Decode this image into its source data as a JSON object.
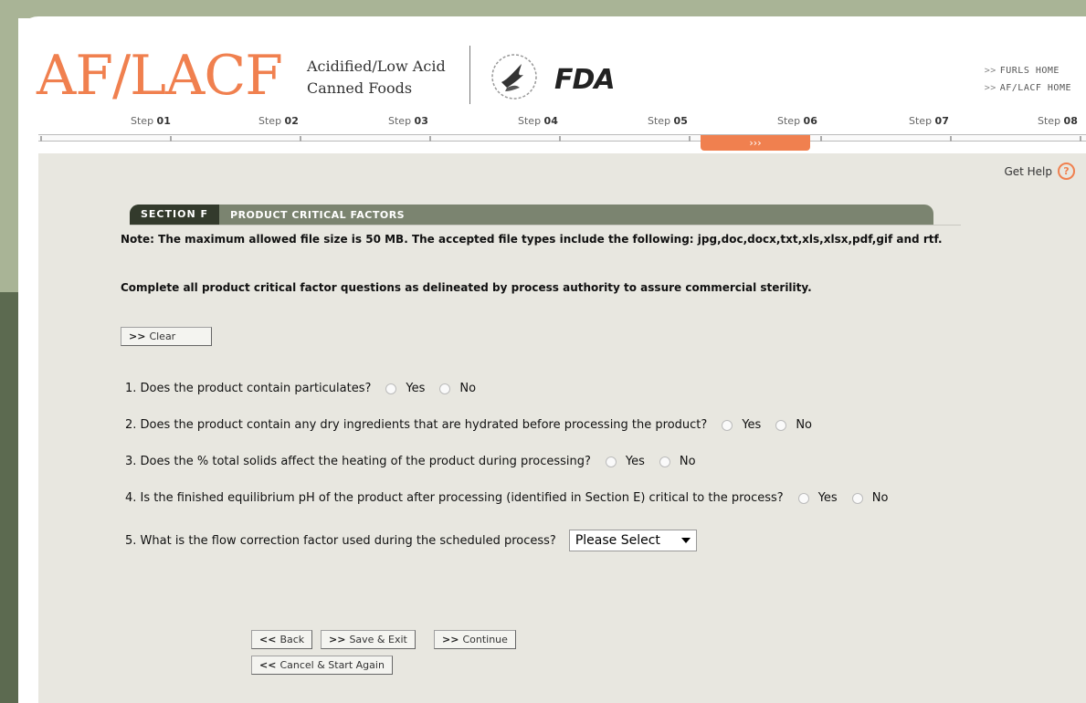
{
  "header": {
    "logo_text": "AF/LACF",
    "logo_subtitle_line1": "Acidified/Low Acid",
    "logo_subtitle_line2": "Canned Foods",
    "fda_text": "FDA",
    "links": [
      {
        "label": "FURLS HOME"
      },
      {
        "label": "AF/LACF HOME"
      }
    ],
    "link_chevron": ">>"
  },
  "steps": [
    {
      "prefix": "Step ",
      "num": "01"
    },
    {
      "prefix": "Step ",
      "num": "02"
    },
    {
      "prefix": "Step ",
      "num": "03"
    },
    {
      "prefix": "Step ",
      "num": "04"
    },
    {
      "prefix": "Step ",
      "num": "05"
    },
    {
      "prefix": "Step ",
      "num": "06"
    },
    {
      "prefix": "Step ",
      "num": "07"
    },
    {
      "prefix": "Step ",
      "num": "08"
    }
  ],
  "current_step_indicator": "›››",
  "help": {
    "label": "Get Help",
    "icon": "?"
  },
  "section": {
    "tab": "SECTION F",
    "title": "PRODUCT CRITICAL FACTORS",
    "note": "Note: The maximum allowed file size is 50 MB. The accepted file types include the following: jpg,doc,docx,txt,xls,xlsx,pdf,gif and rtf.",
    "instruction": "Complete all product critical factor questions as delineated by process authority to assure commercial sterility."
  },
  "clear_button": {
    "chev": ">>",
    "label": "Clear"
  },
  "questions": [
    {
      "text": "1. Does the product contain particulates?",
      "yes": "Yes",
      "no": "No"
    },
    {
      "text": "2. Does the product contain any dry ingredients that are hydrated before processing the product?",
      "yes": "Yes",
      "no": "No"
    },
    {
      "text": "3. Does the % total solids affect the heating of the product during processing?",
      "yes": "Yes",
      "no": "No"
    },
    {
      "text": "4. Is the finished equilibrium pH of the product after processing (identified in Section E) critical to the process?",
      "yes": "Yes",
      "no": "No"
    },
    {
      "text": "5. What is the flow correction factor used during the scheduled process?",
      "select_value": "Please Select"
    }
  ],
  "nav_buttons": {
    "back": {
      "chev": "<<",
      "label": "Back"
    },
    "save_exit": {
      "chev": ">>",
      "label": "Save & Exit"
    },
    "continue": {
      "chev": ">>",
      "label": "Continue"
    },
    "cancel": {
      "chev": "<<",
      "label": "Cancel & Start Again"
    }
  },
  "colors": {
    "accent": "#f0804f",
    "section_bar": "#7b8470",
    "section_tab": "#333a2c",
    "content_bg": "#e8e7e0"
  }
}
